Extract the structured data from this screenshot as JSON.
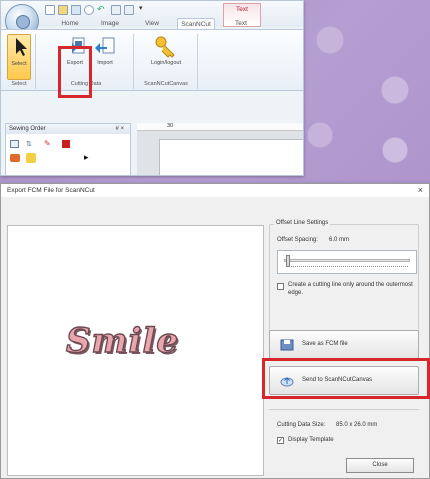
{
  "colors": {
    "highlight": "#d7262c",
    "accent": "#e9a6ae"
  },
  "app": {
    "tabs": [
      "Home",
      "Image",
      "View",
      "ScanNCut",
      "Text"
    ],
    "active_tab": "ScanNCut",
    "contextual_tab": "Text",
    "qat_extra": "▾",
    "ribbon": {
      "select_label": "Select",
      "export_label": "Export",
      "import_label": "Import",
      "login_label": "Login/logout",
      "group_select": "Select",
      "group_cutting": "Cutting Data",
      "group_canvas": "ScanNCutCanvas"
    },
    "panel": {
      "title": "Sewing Order",
      "controls": "# ×"
    },
    "ruler_mark": "30"
  },
  "dialog": {
    "title": "Export FCM File for ScanNCut",
    "close_glyph": "×",
    "preview_text": "Smile",
    "offset_group": "Offset Line Settings",
    "offset_spacing_label": "Offset Spacing:",
    "offset_spacing_value": "6.0 mm",
    "create_outer_label": "Create a cutting line only around the outermost edge.",
    "save_fcm_label": "Save as FCM file",
    "send_canvas_label": "Send to ScanNCutCanvas",
    "cutting_size_label": "Cutting Data Size:",
    "cutting_size_value": "85.0 x 26.0 mm",
    "display_template_label": "Display Template",
    "display_template_checked": "✓",
    "close_label": "Close"
  }
}
